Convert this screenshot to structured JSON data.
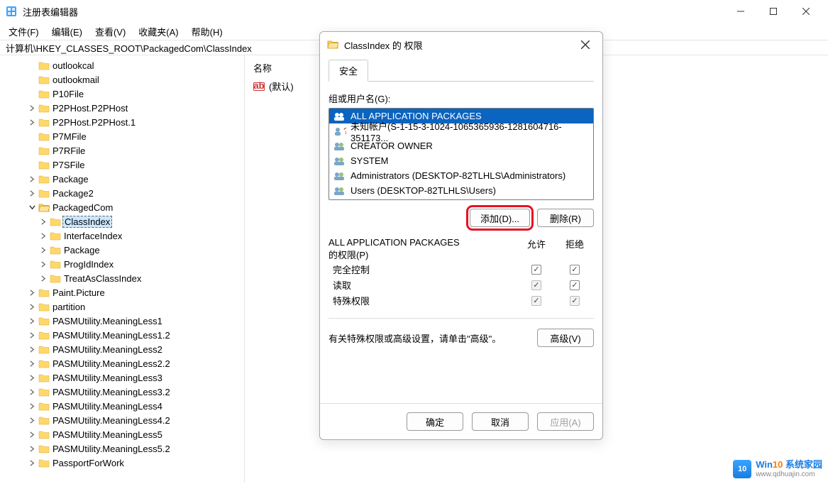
{
  "app": {
    "title": "注册表编辑器",
    "path": "计算机\\HKEY_CLASSES_ROOT\\PackagedCom\\ClassIndex"
  },
  "menu": {
    "file": "文件(F)",
    "edit": "编辑(E)",
    "view": "查看(V)",
    "fav": "收藏夹(A)",
    "help": "帮助(H)"
  },
  "tree": [
    {
      "indent": 2,
      "expand": "none",
      "label": "outlookcal"
    },
    {
      "indent": 2,
      "expand": "none",
      "label": "outlookmail"
    },
    {
      "indent": 2,
      "expand": "none",
      "label": "P10File"
    },
    {
      "indent": 2,
      "expand": "closed",
      "label": "P2PHost.P2PHost"
    },
    {
      "indent": 2,
      "expand": "closed",
      "label": "P2PHost.P2PHost.1"
    },
    {
      "indent": 2,
      "expand": "none",
      "label": "P7MFile"
    },
    {
      "indent": 2,
      "expand": "none",
      "label": "P7RFile"
    },
    {
      "indent": 2,
      "expand": "none",
      "label": "P7SFile"
    },
    {
      "indent": 2,
      "expand": "closed",
      "label": "Package"
    },
    {
      "indent": 2,
      "expand": "closed",
      "label": "Package2"
    },
    {
      "indent": 2,
      "expand": "open",
      "label": "PackagedCom"
    },
    {
      "indent": 3,
      "expand": "closed",
      "label": "ClassIndex",
      "selected": true
    },
    {
      "indent": 3,
      "expand": "closed",
      "label": "InterfaceIndex"
    },
    {
      "indent": 3,
      "expand": "closed",
      "label": "Package"
    },
    {
      "indent": 3,
      "expand": "closed",
      "label": "ProgIdIndex"
    },
    {
      "indent": 3,
      "expand": "closed",
      "label": "TreatAsClassIndex"
    },
    {
      "indent": 2,
      "expand": "closed",
      "label": "Paint.Picture"
    },
    {
      "indent": 2,
      "expand": "closed",
      "label": "partition"
    },
    {
      "indent": 2,
      "expand": "closed",
      "label": "PASMUtility.MeaningLess1"
    },
    {
      "indent": 2,
      "expand": "closed",
      "label": "PASMUtility.MeaningLess1.2"
    },
    {
      "indent": 2,
      "expand": "closed",
      "label": "PASMUtility.MeaningLess2"
    },
    {
      "indent": 2,
      "expand": "closed",
      "label": "PASMUtility.MeaningLess2.2"
    },
    {
      "indent": 2,
      "expand": "closed",
      "label": "PASMUtility.MeaningLess3"
    },
    {
      "indent": 2,
      "expand": "closed",
      "label": "PASMUtility.MeaningLess3.2"
    },
    {
      "indent": 2,
      "expand": "closed",
      "label": "PASMUtility.MeaningLess4"
    },
    {
      "indent": 2,
      "expand": "closed",
      "label": "PASMUtility.MeaningLess4.2"
    },
    {
      "indent": 2,
      "expand": "closed",
      "label": "PASMUtility.MeaningLess5"
    },
    {
      "indent": 2,
      "expand": "closed",
      "label": "PASMUtility.MeaningLess5.2"
    },
    {
      "indent": 2,
      "expand": "closed",
      "label": "PassportForWork"
    }
  ],
  "right": {
    "column_name": "名称",
    "default_value": "(默认)"
  },
  "dialog": {
    "title": "ClassIndex 的 权限",
    "tab_security": "安全",
    "group_label": "组或用户名(G):",
    "users": [
      {
        "icon": "users",
        "label": "ALL APPLICATION PACKAGES",
        "selected": true
      },
      {
        "icon": "unknown",
        "label": "未知帐户(S-1-15-3-1024-1065365936-1281604716-351173...",
        "selected": false
      },
      {
        "icon": "users",
        "label": "CREATOR OWNER",
        "selected": false
      },
      {
        "icon": "users",
        "label": "SYSTEM",
        "selected": false
      },
      {
        "icon": "users",
        "label": "Administrators (DESKTOP-82TLHLS\\Administrators)",
        "selected": false
      },
      {
        "icon": "users",
        "label": "Users (DESKTOP-82TLHLS\\Users)",
        "selected": false
      }
    ],
    "btn_add": "添加(D)...",
    "btn_remove": "删除(R)",
    "perm_title_1": "ALL APPLICATION PACKAGES",
    "perm_title_2": "的权限(P)",
    "col_allow": "允许",
    "col_deny": "拒绝",
    "perms": [
      {
        "name": "完全控制",
        "allow": "unchecked",
        "deny": "unchecked"
      },
      {
        "name": "读取",
        "allow": "checked-disabled",
        "deny": "unchecked"
      },
      {
        "name": "特殊权限",
        "allow": "unchecked-disabled",
        "deny": "unchecked-disabled"
      }
    ],
    "adv_text": "有关特殊权限或高级设置，请单击\"高级\"。",
    "btn_adv": "高级(V)",
    "btn_ok": "确定",
    "btn_cancel": "取消",
    "btn_apply": "应用(A)"
  },
  "watermark": {
    "brand1a": "Win",
    "brand1b": "10",
    "brand1c": " 系统家园",
    "url": "www.qdhuajin.com"
  }
}
